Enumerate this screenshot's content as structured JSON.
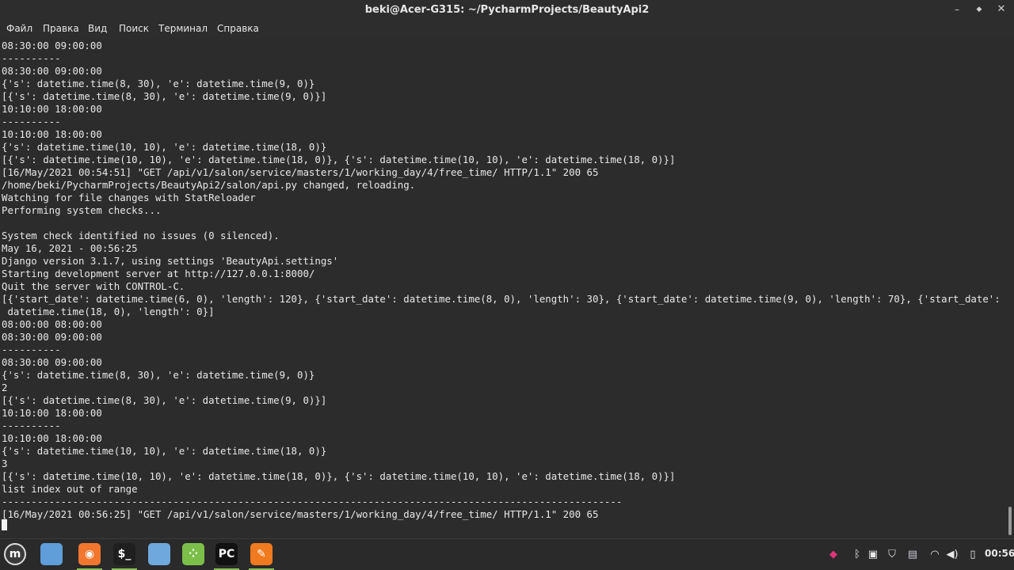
{
  "window": {
    "title": "beki@Acer-G315: ~/PycharmProjects/BeautyApi2",
    "min_glyph": "–",
    "max_glyph": "◆",
    "close_glyph": "✕"
  },
  "menu": [
    "Файл",
    "Правка",
    "Вид",
    "Поиск",
    "Терминал",
    "Справка"
  ],
  "terminal": {
    "lines": [
      "08:30:00 09:00:00",
      "----------",
      "08:30:00 09:00:00",
      "{'s': datetime.time(8, 30), 'e': datetime.time(9, 0)}",
      "[{'s': datetime.time(8, 30), 'e': datetime.time(9, 0)}]",
      "10:10:00 18:00:00",
      "----------",
      "10:10:00 18:00:00",
      "{'s': datetime.time(10, 10), 'e': datetime.time(18, 0)}",
      "[{'s': datetime.time(10, 10), 'e': datetime.time(18, 0)}, {'s': datetime.time(10, 10), 'e': datetime.time(18, 0)}]",
      "[16/May/2021 00:54:51] \"GET /api/v1/salon/service/masters/1/working_day/4/free_time/ HTTP/1.1\" 200 65",
      "/home/beki/PycharmProjects/BeautyApi2/salon/api.py changed, reloading.",
      "Watching for file changes with StatReloader",
      "Performing system checks...",
      "",
      "System check identified no issues (0 silenced).",
      "May 16, 2021 - 00:56:25",
      "Django version 3.1.7, using settings 'BeautyApi.settings'",
      "Starting development server at http://127.0.0.1:8000/",
      "Quit the server with CONTROL-C.",
      "[{'start_date': datetime.time(6, 0), 'length': 120}, {'start_date': datetime.time(8, 0), 'length': 30}, {'start_date': datetime.time(9, 0), 'length': 70}, {'start_date':",
      " datetime.time(18, 0), 'length': 0}]",
      "08:00:00 08:00:00",
      "08:30:00 09:00:00",
      "----------",
      "08:30:00 09:00:00",
      "{'s': datetime.time(8, 30), 'e': datetime.time(9, 0)}",
      "2",
      "[{'s': datetime.time(8, 30), 'e': datetime.time(9, 0)}]",
      "10:10:00 18:00:00",
      "----------",
      "10:10:00 18:00:00",
      "{'s': datetime.time(10, 10), 'e': datetime.time(18, 0)}",
      "3",
      "[{'s': datetime.time(10, 10), 'e': datetime.time(18, 0)}, {'s': datetime.time(10, 10), 'e': datetime.time(18, 0)}]",
      "list index out of range",
      "---------------------------------------------------------------------------------------------------------",
      "[16/May/2021 00:56:25] \"GET /api/v1/salon/service/masters/1/working_day/4/free_time/ HTTP/1.1\" 200 65"
    ]
  },
  "taskbar": {
    "apps": [
      {
        "name": "menu-icon",
        "glyph": "m",
        "color": "#3a3a3a",
        "active": false
      },
      {
        "name": "files-icon",
        "glyph": "",
        "color": "#5f9ed8",
        "active": false
      },
      {
        "name": "firefox-icon",
        "glyph": "◉",
        "color": "#f2762e",
        "active": true
      },
      {
        "name": "terminal-icon",
        "glyph": "$_",
        "color": "#1f1f1f",
        "active": true
      },
      {
        "name": "folder-icon",
        "glyph": "",
        "color": "#6fa8dc",
        "active": false
      },
      {
        "name": "apps-grid-icon",
        "glyph": "⁘",
        "color": "#7bbf4a",
        "active": false
      },
      {
        "name": "pycharm-icon",
        "glyph": "PC",
        "color": "#111111",
        "active": true
      },
      {
        "name": "sublime-icon",
        "glyph": "✎",
        "color": "#f07a1f",
        "active": true
      }
    ],
    "tray": [
      {
        "name": "app-tray-icon",
        "glyph": "◆",
        "color": "#e0357a"
      },
      {
        "name": "bluetooth-icon",
        "glyph": "ᛒ",
        "color": "#e8e8e8"
      },
      {
        "name": "clipboard-icon",
        "glyph": "▣",
        "color": "#e8e8e8"
      },
      {
        "name": "shield-icon",
        "glyph": "⛉",
        "color": "#e8e8e8"
      },
      {
        "name": "keyboard-layout-icon",
        "glyph": "▤",
        "color": "#c8c8d8"
      },
      {
        "name": "wifi-icon",
        "glyph": "◠",
        "color": "#e8e8e8"
      },
      {
        "name": "volume-icon",
        "glyph": "◀)",
        "color": "#e8e8e8"
      },
      {
        "name": "battery-icon",
        "glyph": "▯",
        "color": "#e8e8e8"
      }
    ],
    "clock": "00:56"
  }
}
